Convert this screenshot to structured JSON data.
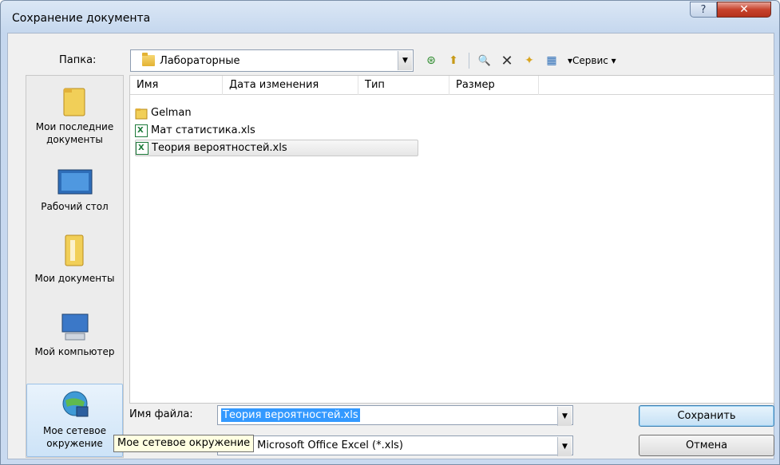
{
  "window": {
    "title": "Сохранение документа",
    "help_glyph": "?",
    "close_glyph": "✕"
  },
  "folder": {
    "label": "Папка:",
    "current": "Лабораторные",
    "arrow": "▼"
  },
  "toolbar": {
    "back_glyph": "⊛",
    "up_glyph": "⬆",
    "search_glyph": "🔍",
    "delete_glyph": "✕",
    "newfolder_glyph": "✦",
    "views_glyph": "▦",
    "service_label": "▾Сервис ▾"
  },
  "places": [
    {
      "label": "Мои последние документы"
    },
    {
      "label": "Рабочий стол"
    },
    {
      "label": "Мои документы"
    },
    {
      "label": "Мой компьютер"
    },
    {
      "label": "Мое сетевое окружение"
    }
  ],
  "columns": [
    "Имя",
    "Дата изменения",
    "Тип",
    "Размер"
  ],
  "files": [
    {
      "name": "Gelman",
      "kind": "folder"
    },
    {
      "name": "Мат статистика.xls",
      "kind": "xls"
    },
    {
      "name": "Теория вероятностей.xls",
      "kind": "xls",
      "selected": true
    }
  ],
  "filename": {
    "label": "Имя файла:",
    "value": "Теория вероятностей.xls",
    "arrow": "▼"
  },
  "filetype": {
    "value": "Книга Microsoft Office Excel (*.xls)",
    "arrow": "▼"
  },
  "buttons": {
    "save": "Сохранить",
    "cancel": "Отмена"
  },
  "tooltip": "Мое сетевое окружение",
  "colors": {
    "selection": "#3399ff",
    "tooltip_bg": "#ffffe1",
    "close": "#c7432c"
  }
}
